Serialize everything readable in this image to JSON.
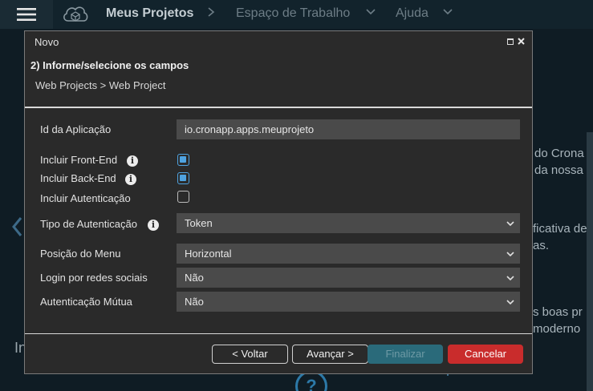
{
  "topbar": {
    "brand": "Meus Projetos",
    "nav": [
      "Espaço de Trabalho",
      "Ajuda"
    ]
  },
  "background": {
    "snippets": [
      "do Crona",
      "da nossa",
      "ficativa de",
      "as.",
      "s boas pr",
      "moderno",
      "In"
    ]
  },
  "modal": {
    "title": "Novo",
    "step_title": "2) Informe/selecione os campos",
    "breadcrumb": "Web Projects > Web Project",
    "fields": {
      "app_id": {
        "label": "Id da Aplicação",
        "value": "io.cronapp.apps.meuprojeto"
      },
      "frontend": {
        "label": "Incluir Front-End",
        "checked": true
      },
      "backend": {
        "label": "Incluir Back-End",
        "checked": true
      },
      "auth": {
        "label": "Incluir Autenticação",
        "checked": false
      },
      "auth_type": {
        "label": "Tipo de Autenticação",
        "value": "Token"
      },
      "menu_pos": {
        "label": "Posição do Menu",
        "value": "Horizontal"
      },
      "social_login": {
        "label": "Login por redes sociais",
        "value": "Não"
      },
      "mutual_auth": {
        "label": "Autenticação Mútua",
        "value": "Não"
      }
    },
    "buttons": {
      "back": "< Voltar",
      "next": "Avançar >",
      "finish": "Finalizar",
      "cancel": "Cancelar"
    }
  },
  "colors": {
    "accent": "#4fa3e0",
    "cancel": "#c92c2c",
    "finish_disabled": "#2a6a7a",
    "modal_bg": "#2a2a2a",
    "field_bg": "#4a4a4a"
  },
  "icons": [
    "hamburger-icon",
    "cloud-icon",
    "chevron-right-icon",
    "chevron-down-icon",
    "info-icon",
    "maximize-icon",
    "close-icon"
  ]
}
